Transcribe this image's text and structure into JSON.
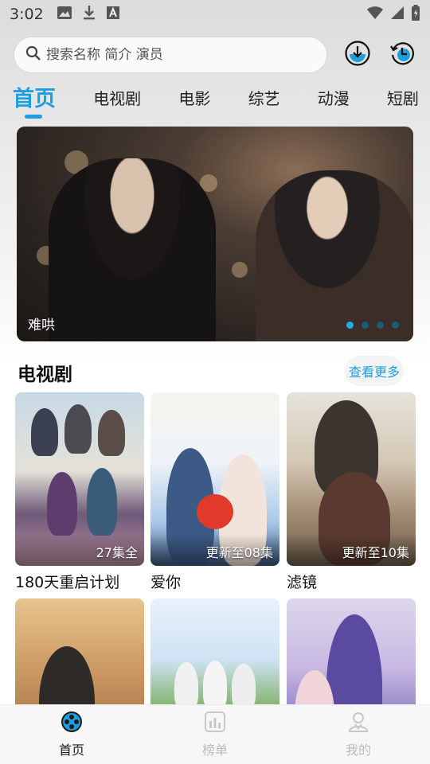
{
  "status_bar": {
    "time": "3:02",
    "icons": [
      "image-icon",
      "download-icon",
      "font-icon"
    ],
    "right_icons": [
      "wifi-icon",
      "signal-icon",
      "battery-icon"
    ]
  },
  "search": {
    "placeholder": "搜索名称 简介 演员"
  },
  "header_buttons": [
    "download-icon",
    "history-icon"
  ],
  "tabs": [
    {
      "label": "首页",
      "active": true
    },
    {
      "label": "电视剧",
      "active": false
    },
    {
      "label": "电影",
      "active": false
    },
    {
      "label": "综艺",
      "active": false
    },
    {
      "label": "动漫",
      "active": false
    },
    {
      "label": "短剧",
      "active": false
    }
  ],
  "banner": {
    "caption": "难哄",
    "slide_count": 4,
    "active_slide": 1
  },
  "section": {
    "title": "电视剧",
    "more_label": "查看更多"
  },
  "cards": [
    {
      "title": "180天重启计划",
      "badge": "27集全"
    },
    {
      "title": "爱你",
      "badge": "更新至08集"
    },
    {
      "title": "滤镜",
      "badge": "更新至10集"
    },
    {
      "title": "",
      "badge": ""
    },
    {
      "title": "",
      "badge": ""
    },
    {
      "title": "",
      "badge": ""
    }
  ],
  "bottom_nav": [
    {
      "label": "首页",
      "icon": "film-reel-icon",
      "active": true
    },
    {
      "label": "榜单",
      "icon": "chart-icon",
      "active": false
    },
    {
      "label": "我的",
      "icon": "profile-icon",
      "active": false
    }
  ],
  "colors": {
    "accent": "#1e9ee0",
    "inactive_nav": "#bbbbbb"
  }
}
